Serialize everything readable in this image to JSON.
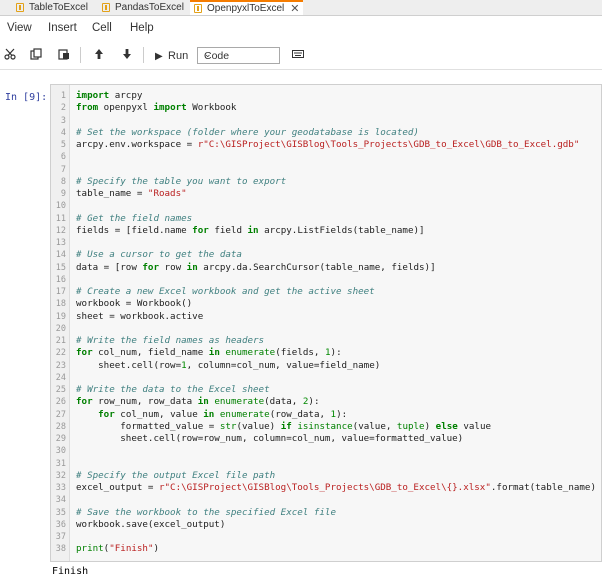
{
  "tabs": [
    {
      "label": "TableToExcel"
    },
    {
      "label": "PandasToExcel"
    },
    {
      "label": "OpenpyxlToExcel",
      "close": "✕"
    }
  ],
  "menu": [
    "View",
    "Insert",
    "Cell",
    "Help"
  ],
  "toolbar": {
    "run_label": "Run",
    "cell_type": "Code"
  },
  "cell": {
    "prompt": "In [9]:",
    "code_lines": [
      [
        {
          "t": "import",
          "c": "kw"
        },
        {
          "t": " arcpy"
        }
      ],
      [
        {
          "t": "from",
          "c": "kw"
        },
        {
          "t": " openpyxl "
        },
        {
          "t": "import",
          "c": "kw"
        },
        {
          "t": " Workbook"
        }
      ],
      [],
      [
        {
          "t": "# Set the workspace (folder where your geodatabase is located)",
          "c": "cm"
        }
      ],
      [
        {
          "t": "arcpy.env.workspace = "
        },
        {
          "t": "r\"C:\\GISProject\\GISBlog\\Tools_Projects\\GDB_to_Excel\\GDB_to_Excel.gdb\"",
          "c": "str"
        }
      ],
      [],
      [],
      [
        {
          "t": "# Specify the table you want to export",
          "c": "cm"
        }
      ],
      [
        {
          "t": "table_name = "
        },
        {
          "t": "\"Roads\"",
          "c": "str"
        }
      ],
      [],
      [
        {
          "t": "# Get the field names",
          "c": "cm"
        }
      ],
      [
        {
          "t": "fields = [field.name "
        },
        {
          "t": "for",
          "c": "kw"
        },
        {
          "t": " field "
        },
        {
          "t": "in",
          "c": "kw"
        },
        {
          "t": " arcpy.ListFields(table_name)]"
        }
      ],
      [],
      [
        {
          "t": "# Use a cursor to get the data",
          "c": "cm"
        }
      ],
      [
        {
          "t": "data = [row "
        },
        {
          "t": "for",
          "c": "kw"
        },
        {
          "t": " row "
        },
        {
          "t": "in",
          "c": "kw"
        },
        {
          "t": " arcpy.da.SearchCursor(table_name, fields)]"
        }
      ],
      [],
      [
        {
          "t": "# Create a new Excel workbook and get the active sheet",
          "c": "cm"
        }
      ],
      [
        {
          "t": "workbook = Workbook()"
        }
      ],
      [
        {
          "t": "sheet = workbook.active"
        }
      ],
      [],
      [
        {
          "t": "# Write the field names as headers",
          "c": "cm"
        }
      ],
      [
        {
          "t": "for",
          "c": "kw"
        },
        {
          "t": " col_num, field_name "
        },
        {
          "t": "in",
          "c": "kw"
        },
        {
          "t": " "
        },
        {
          "t": "enumerate",
          "c": "bi"
        },
        {
          "t": "(fields, "
        },
        {
          "t": "1",
          "c": "num"
        },
        {
          "t": "):"
        }
      ],
      [
        {
          "t": "    sheet.cell(row="
        },
        {
          "t": "1",
          "c": "num"
        },
        {
          "t": ", column=col_num, value=field_name)"
        }
      ],
      [],
      [
        {
          "t": "# Write the data to the Excel sheet",
          "c": "cm"
        }
      ],
      [
        {
          "t": "for",
          "c": "kw"
        },
        {
          "t": " row_num, row_data "
        },
        {
          "t": "in",
          "c": "kw"
        },
        {
          "t": " "
        },
        {
          "t": "enumerate",
          "c": "bi"
        },
        {
          "t": "(data, "
        },
        {
          "t": "2",
          "c": "num"
        },
        {
          "t": "):"
        }
      ],
      [
        {
          "t": "    "
        },
        {
          "t": "for",
          "c": "kw"
        },
        {
          "t": " col_num, value "
        },
        {
          "t": "in",
          "c": "kw"
        },
        {
          "t": " "
        },
        {
          "t": "enumerate",
          "c": "bi"
        },
        {
          "t": "(row_data, "
        },
        {
          "t": "1",
          "c": "num"
        },
        {
          "t": "):"
        }
      ],
      [
        {
          "t": "        formatted_value = "
        },
        {
          "t": "str",
          "c": "bi"
        },
        {
          "t": "(value) "
        },
        {
          "t": "if",
          "c": "kw"
        },
        {
          "t": " "
        },
        {
          "t": "isinstance",
          "c": "bi"
        },
        {
          "t": "(value, "
        },
        {
          "t": "tuple",
          "c": "bi"
        },
        {
          "t": ") "
        },
        {
          "t": "else",
          "c": "kw"
        },
        {
          "t": " value"
        }
      ],
      [
        {
          "t": "        sheet.cell(row=row_num, column=col_num, value=formatted_value)"
        }
      ],
      [],
      [],
      [
        {
          "t": "# Specify the output Excel file path",
          "c": "cm"
        }
      ],
      [
        {
          "t": "excel_output = "
        },
        {
          "t": "r\"C:\\GISProject\\GISBlog\\Tools_Projects\\GDB_to_Excel\\{}.xlsx\"",
          "c": "str"
        },
        {
          "t": ".format(table_name)"
        }
      ],
      [],
      [
        {
          "t": "# Save the workbook to the specified Excel file",
          "c": "cm"
        }
      ],
      [
        {
          "t": "workbook.save(excel_output)"
        }
      ],
      [],
      [
        {
          "t": "print",
          "c": "bi"
        },
        {
          "t": "("
        },
        {
          "t": "\"Finish\"",
          "c": "str"
        },
        {
          "t": ")"
        }
      ]
    ],
    "output": "Finish"
  }
}
